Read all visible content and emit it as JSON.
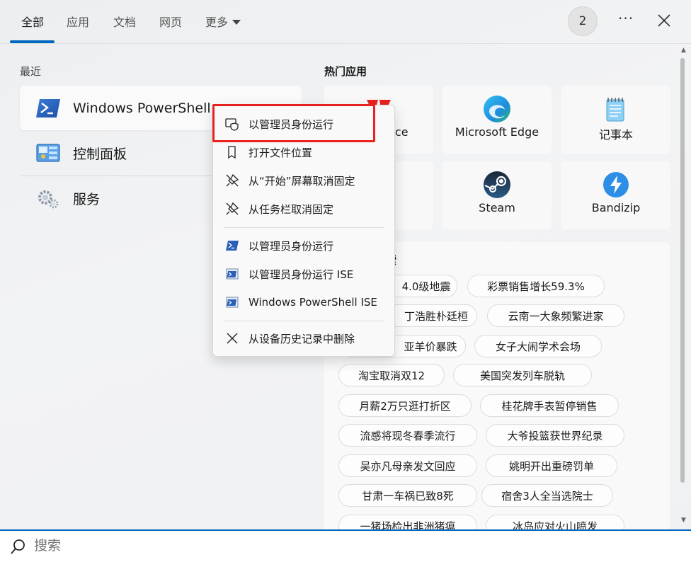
{
  "tabs": [
    {
      "label": "全部",
      "active": true
    },
    {
      "label": "应用"
    },
    {
      "label": "文档"
    },
    {
      "label": "网页"
    },
    {
      "label": "更多"
    }
  ],
  "header": {
    "badge": "2",
    "more_icon": "ellipsis-icon",
    "close_icon": "close-icon"
  },
  "recent": {
    "title": "最近",
    "items": [
      {
        "label": "Windows PowerShell",
        "icon": "powershell-icon"
      },
      {
        "label": "控制面板",
        "icon": "control-panel-icon"
      },
      {
        "label": "服务",
        "icon": "services-gear-icon"
      }
    ]
  },
  "hot_apps": {
    "title": "热门应用",
    "items": [
      {
        "label": "ice",
        "icon": "wps-office-icon"
      },
      {
        "label": "Microsoft Edge",
        "icon": "edge-icon"
      },
      {
        "label": "记事本",
        "icon": "notepad-icon"
      },
      {
        "label": "",
        "icon": "hidden-app-icon"
      },
      {
        "label": "Steam",
        "icon": "steam-icon"
      },
      {
        "label": "Bandizip",
        "icon": "bandizip-icon"
      }
    ]
  },
  "hot_search": {
    "title": "索",
    "items": [
      "4.0级地震",
      "彩票销售增长59.3%",
      "丁浩胜朴廷桓",
      "云南一大象频繁进家",
      "亚羊价暴跌",
      "女子大闹学术会场",
      "淘宝取消双12",
      "美国突发列车脱轨",
      "月薪2万只逛打折区",
      "桂花牌手表暂停销售",
      "流感将现冬春季流行",
      "大爷投篮获世界纪录",
      "吴亦凡母亲发文回应",
      "姚明开出重磅罚单",
      "甘肃一车祸已致8死",
      "宿舍3人全当选院士",
      "一猪场检出非洲猪瘟",
      "冰岛应对火山喷发"
    ]
  },
  "context_menu": {
    "items": [
      {
        "label": "以管理员身份运行",
        "icon": "shield-icon"
      },
      {
        "label": "打开文件位置",
        "icon": "file-location-icon"
      },
      {
        "label": "从“开始”屏幕取消固定",
        "icon": "unpin-icon"
      },
      {
        "label": "从任务栏取消固定",
        "icon": "unpin-icon"
      },
      {
        "label": "以管理员身份运行",
        "icon": "powershell-icon"
      },
      {
        "label": "以管理员身份运行 ISE",
        "icon": "powershell-ise-icon"
      },
      {
        "label": "Windows PowerShell ISE",
        "icon": "powershell-ise-icon"
      },
      {
        "label": "从设备历史记录中删除",
        "icon": "close-icon"
      }
    ]
  },
  "search": {
    "placeholder": "搜索",
    "value": ""
  },
  "colors": {
    "accent": "#0067c0",
    "highlight": "#e8221f"
  }
}
